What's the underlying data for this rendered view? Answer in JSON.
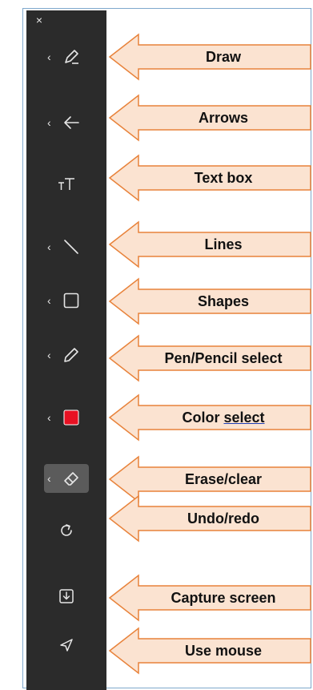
{
  "toolbar": {
    "close_glyph": "×",
    "items": [
      {
        "name": "draw",
        "icon": "pen-icon",
        "has_chevron": true
      },
      {
        "name": "arrows",
        "icon": "arrow-left-icon",
        "has_chevron": true
      },
      {
        "name": "text-box",
        "icon": "text-size-icon",
        "has_chevron": false
      },
      {
        "name": "lines",
        "icon": "line-icon",
        "has_chevron": true
      },
      {
        "name": "shapes",
        "icon": "square-icon",
        "has_chevron": true
      },
      {
        "name": "pen-pencil",
        "icon": "pencil-icon",
        "has_chevron": true
      },
      {
        "name": "color",
        "icon": "color-swatch-icon",
        "has_chevron": true,
        "color": "#e81123"
      },
      {
        "name": "eraser",
        "icon": "eraser-icon",
        "has_chevron": true,
        "selected": true
      },
      {
        "name": "undo-redo",
        "icon": "redo-icon",
        "has_chevron": false
      },
      {
        "name": "capture",
        "icon": "download-icon",
        "has_chevron": false
      },
      {
        "name": "mouse",
        "icon": "cursor-icon",
        "has_chevron": false
      }
    ]
  },
  "callouts": [
    {
      "label": "Draw"
    },
    {
      "label": "Arrows"
    },
    {
      "label": "Text box"
    },
    {
      "label": "Lines"
    },
    {
      "label": "Shapes"
    },
    {
      "label": "Pen/Pencil select"
    },
    {
      "label_prefix": "Color ",
      "label_underlined": "select"
    },
    {
      "label": "Erase/clear"
    },
    {
      "label": "Undo/redo"
    },
    {
      "label": "Capture screen"
    },
    {
      "label": "Use mouse"
    }
  ],
  "colors": {
    "toolbar_bg": "#2b2b2b",
    "callout_fill": "#fbe3d1",
    "callout_stroke": "#e8823a",
    "swatch_red": "#e81123"
  }
}
